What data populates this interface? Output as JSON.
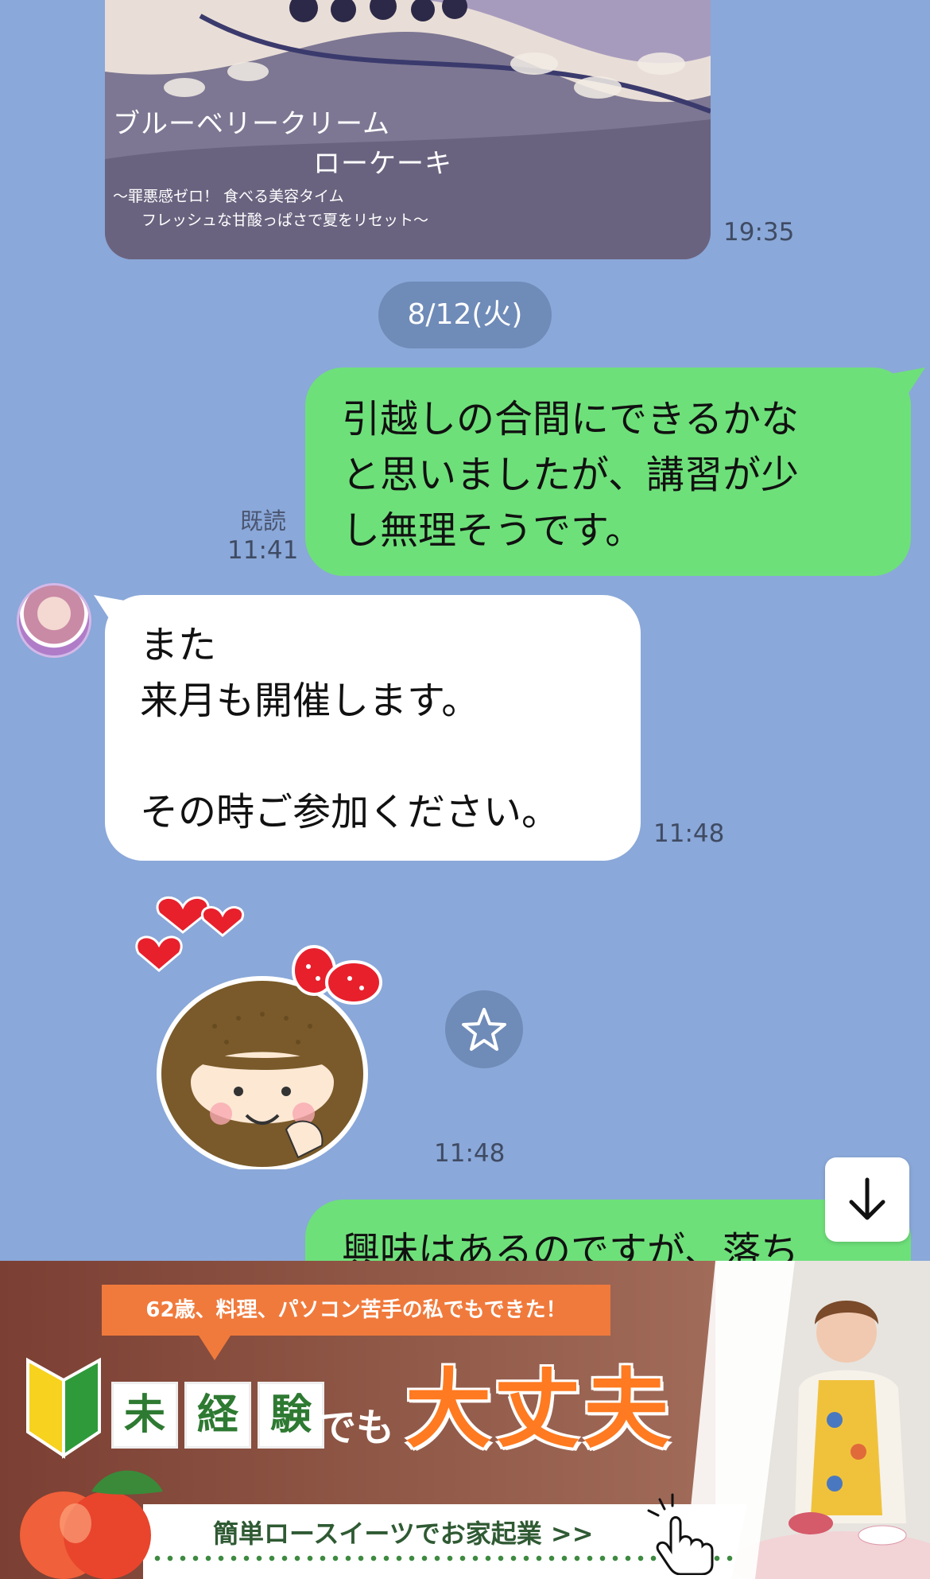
{
  "image_card": {
    "title_line1": "ブルーベリークリーム",
    "title_line2": "ローケーキ",
    "subtitle_line1": "〜罪悪感ゼロ！ 食べる美容タイム",
    "subtitle_line2": "フレッシュな甘酸っぱさで夏をリセット〜",
    "time": "19:35"
  },
  "date_separator": "8/12(火)",
  "messages": [
    {
      "side": "right",
      "lines": [
        "引越しの合間にできるかな",
        "と思いましたが、講習が少",
        "し無理そうです。"
      ],
      "read_label": "既読",
      "time": "11:41"
    },
    {
      "side": "left",
      "lines": [
        "また",
        "来月も開催します。",
        "",
        "その時ご参加ください。"
      ],
      "time": "11:48"
    },
    {
      "side": "left",
      "type": "sticker",
      "sticker": "girl-with-hearts-sticker",
      "time": "11:48"
    },
    {
      "side": "right",
      "partial_line": "興味はあるのですが、落ち"
    }
  ],
  "icons": {
    "star": "star-icon",
    "scroll_down": "arrow-down-icon"
  },
  "banner": {
    "ribbon": "62歳、料理、パソコン苦手の私でもできた！",
    "kanji": [
      "未",
      "経",
      "験"
    ],
    "demo": "でも",
    "headline": "大丈夫",
    "cta": "簡単ロースイーツでお家起業 >>"
  },
  "colors": {
    "background": "#8aa8d9",
    "bubble_green": "#6ee07a",
    "bubble_white": "#ffffff",
    "accent_orange": "#ff7a20"
  }
}
